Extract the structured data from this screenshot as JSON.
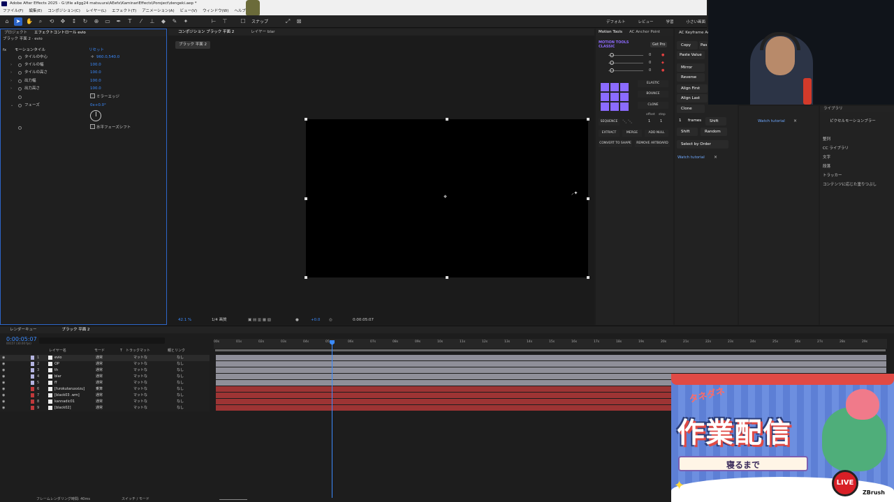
{
  "window": {
    "title": "Adobe After Effects 2025 - G:\\file allgg24 matsuura\\AEefx\\KaminariEffects\\Poroject\\dengeki.aep *",
    "menus": [
      "ファイル(F)",
      "編集(E)",
      "コンポジション(C)",
      "レイヤー(L)",
      "エフェクト(T)",
      "アニメーション(A)",
      "ビュー(V)",
      "ウィンドウ(W)",
      "ヘルプ(H)"
    ]
  },
  "toolbar": {
    "snap_label": "スナップ",
    "workspaces": [
      "デフォルト",
      "レビュー",
      "学習",
      "小さい画面"
    ]
  },
  "effect_controls": {
    "tabs": [
      "プロジェクト",
      "エフェクトコントロール evio"
    ],
    "layer_path": "ブラック 平面 2 · evio",
    "effect_name": "モーションタイル",
    "reset_label": "リセット",
    "params": [
      {
        "name": "タイルの中心",
        "value": "960.0,540.0"
      },
      {
        "name": "タイルの幅",
        "value": "100.0"
      },
      {
        "name": "タイルの高さ",
        "value": "100.0"
      },
      {
        "name": "出力幅",
        "value": "100.0"
      },
      {
        "name": "出力高さ",
        "value": "100.0"
      }
    ],
    "mirror_edges_label": "ミラーエッジ",
    "phase_label": "フェーズ",
    "phase_value": "0x+0.0°",
    "horiz_phase_label": "水平フェーズシフト"
  },
  "composition": {
    "tab_label": "コンポジション ブラック 平面 2",
    "layer_tab_label": "レイヤー blar",
    "breadcrumb": "ブラック 平面 2",
    "zoom": "42.1 %",
    "resolution": "1/4 画質",
    "exposure": "+0.0",
    "timecode": "0:00:05:07"
  },
  "motion_tools": {
    "tabs": [
      "Motion Tools",
      "AC Anchor Point"
    ],
    "brand_line1": "MOTION TOOLS",
    "brand_line2": "CLASSIC",
    "get_pro": "Get Pro",
    "slider_values": [
      "0",
      "0",
      "0"
    ],
    "easing": [
      "ELASTIC",
      "BOUNCE",
      "CLONE"
    ],
    "sequence": "SEQUENCE",
    "offset_label": "offset",
    "step_label": "step",
    "offset_value": "1",
    "step_value": "1",
    "actions": [
      "EXTRACT",
      "MERGE",
      "ADD NULL"
    ],
    "actions2": [
      "CONVERT TO SHAPE",
      "REMOVE ARTBOARD"
    ]
  },
  "keyframe_panel": {
    "title": "AC Keyframe Act",
    "copy": "Copy",
    "paste_short": "Pas",
    "paste_value": "Paste Value",
    "buttons": [
      "Mirror",
      "Reverse",
      "Align First",
      "Align Last",
      "Clone"
    ],
    "frames_value": "1",
    "frames_label": "frames",
    "shift_label": "Shift",
    "shift2": "Shift",
    "random": "Random",
    "select_by_order": "Select by Order",
    "watch_tutorial": "Watch tutorial"
  },
  "library_panel": {
    "tab": "ライブラリ",
    "header": "ピクセルモーションブラー",
    "watch_tutorial": "Watch tutorial",
    "items": [
      "整列",
      "CC ライブラリ",
      "文字",
      "段落",
      "トラッカー",
      "コンテンツに応じた塗りつぶし"
    ]
  },
  "timeline": {
    "tabs": [
      "レンダーキュー",
      "ブラック 平面 2"
    ],
    "timecode": "0:00:05:07",
    "fps_line": "00157 (30.00 fps)",
    "columns": [
      "レイヤー名",
      "モード",
      "T",
      "トラックマット",
      "親とリンク"
    ],
    "ruler": [
      "00s",
      "01s",
      "02s",
      "03s",
      "04s",
      "05s",
      "06s",
      "07s",
      "08s",
      "09s",
      "10s",
      "11s",
      "12s",
      "13s",
      "14s",
      "15s",
      "16s",
      "17s",
      "18s",
      "19s",
      "20s",
      "21s",
      "22s",
      "23s",
      "24s",
      "25s",
      "26s",
      "27s",
      "28s",
      "29s"
    ],
    "layers": [
      {
        "num": "1",
        "name": "evio",
        "mode": "通常",
        "matte": "マットな",
        "parent": "なし",
        "color": "#b4b4e0"
      },
      {
        "num": "2",
        "name": "OP",
        "mode": "通常",
        "matte": "マットな",
        "parent": "なし",
        "color": "#b4b4e0"
      },
      {
        "num": "3",
        "name": "th",
        "mode": "通常",
        "matte": "マットな",
        "parent": "なし",
        "color": "#b4b4e0"
      },
      {
        "num": "4",
        "name": "blar",
        "mode": "通常",
        "matte": "マットな",
        "parent": "なし",
        "color": "#b4b4e0"
      },
      {
        "num": "5",
        "name": "ff",
        "mode": "通常",
        "matte": "マットな",
        "parent": "なし",
        "color": "#b4b4e0"
      },
      {
        "num": "6",
        "name": "[furokutaruxxizu]",
        "mode": "乗算",
        "matte": "マットな",
        "parent": "なし",
        "color": "#c0393b"
      },
      {
        "num": "7",
        "name": "[black03 .wm]",
        "mode": "通常",
        "matte": "マットな",
        "parent": "なし",
        "color": "#c0393b"
      },
      {
        "num": "8",
        "name": "kannadic01",
        "mode": "通常",
        "matte": "マットな",
        "parent": "なし",
        "color": "#c0393b"
      },
      {
        "num": "9",
        "name": "[black02]",
        "mode": "通常",
        "matte": "マットな",
        "parent": "なし",
        "color": "#c0393b"
      }
    ],
    "footer_render_time": "フレームレンダリング時間: 40ms",
    "footer_switch": "スイッチ / モード"
  },
  "promo": {
    "small_title": "タネダネ",
    "big_title": "作業配信",
    "subtitle": "寝るまで",
    "live": "LIVE",
    "brand": "ZBrush"
  },
  "colors": {
    "accent_blue": "#2c65c8",
    "value_blue": "#3b8bff",
    "label_purple": "#b4b4e0",
    "label_red": "#c0393b",
    "bar_grey": "#8f8f99",
    "bar_red": "#9d3434",
    "cti_blue": "#3b8bff"
  }
}
